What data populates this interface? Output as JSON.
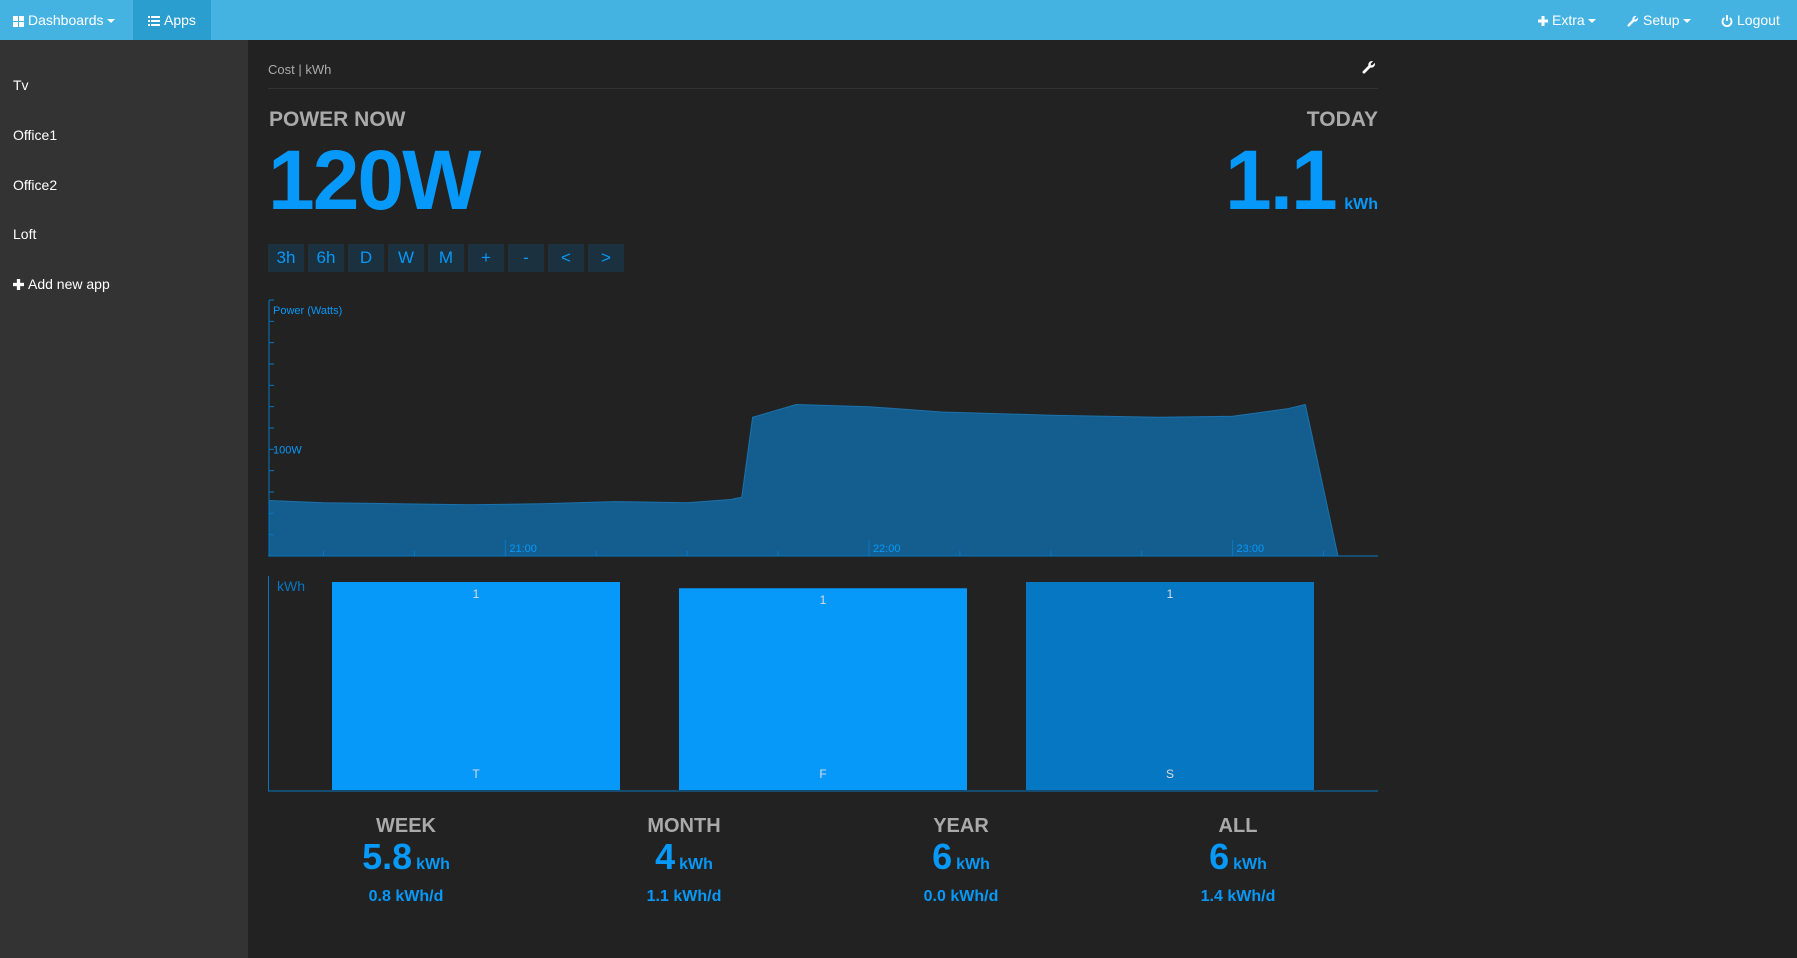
{
  "navbar": {
    "dashboards": "Dashboards",
    "apps": "Apps",
    "extra": "Extra",
    "setup": "Setup",
    "logout": "Logout"
  },
  "sidebar": {
    "items": [
      {
        "label": "Tv"
      },
      {
        "label": "Office1"
      },
      {
        "label": "Office2"
      },
      {
        "label": "Loft"
      }
    ],
    "add_label": "Add new app"
  },
  "app": {
    "title": "Cost | kWh",
    "power_now_label": "POWER NOW",
    "power_now_value": "120W",
    "today_label": "TODAY",
    "today_value": "1.1",
    "today_unit": "kWh",
    "zoom_buttons": [
      "3h",
      "6h",
      "D",
      "W",
      "M",
      "+",
      "-",
      "<",
      ">"
    ]
  },
  "stats": [
    {
      "label": "WEEK",
      "value": "5.8",
      "unit": "kWh",
      "per_day": "0.8 kWh/d"
    },
    {
      "label": "MONTH",
      "value": "4",
      "unit": "kWh",
      "per_day": "1.1 kWh/d"
    },
    {
      "label": "YEAR",
      "value": "6",
      "unit": "kWh",
      "per_day": "0.0 kWh/d"
    },
    {
      "label": "ALL",
      "value": "6",
      "unit": "kWh",
      "per_day": "1.4 kWh/d"
    }
  ],
  "colors": {
    "accent": "#0699fa",
    "navbar": "#44b3e2",
    "area_fill": "#145e8f"
  },
  "chart_data": [
    {
      "type": "area",
      "ylabel": "Power (Watts)",
      "y_tick_labels": [
        "100W"
      ],
      "x_tick_labels": [
        "21:00",
        "22:00",
        "23:00"
      ],
      "ylim": [
        0,
        240
      ],
      "xlim": [
        20.35,
        23.4
      ],
      "series": [
        {
          "x": [
            20.35,
            20.5,
            20.7,
            20.9,
            21.1,
            21.3,
            21.5,
            21.62,
            21.65,
            21.68,
            21.8,
            22.0,
            22.2,
            22.5,
            22.8,
            23.0,
            23.15,
            23.2,
            23.29
          ],
          "values": [
            52,
            50,
            49,
            48,
            49,
            51,
            50,
            53,
            55,
            130,
            142,
            140,
            135,
            132,
            130,
            131,
            138,
            142,
            0
          ]
        }
      ]
    },
    {
      "type": "bar",
      "ylabel": "kWh",
      "categories": [
        "T",
        "F",
        "S"
      ],
      "values": [
        1,
        0.97,
        1
      ],
      "value_labels": [
        "1",
        "1",
        "1"
      ],
      "colors": [
        "#0699fa",
        "#0699fa",
        "#0677c2"
      ]
    }
  ]
}
